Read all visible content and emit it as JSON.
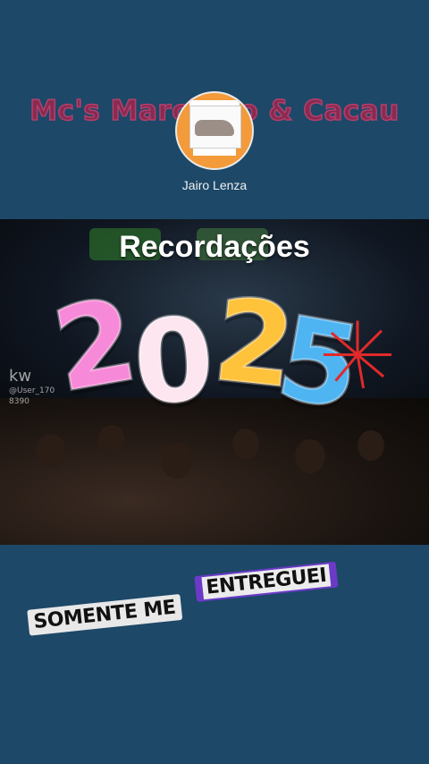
{
  "profile": {
    "overlay_title": "Mc's Marcinho & Cacau",
    "author_name": "Jairo Lenza"
  },
  "video": {
    "headline": "Recordações",
    "year_digits": [
      "2",
      "0",
      "2",
      "5"
    ],
    "watermark_app": "kw",
    "watermark_user": "@User_170",
    "watermark_id": "8390"
  },
  "caption": {
    "part1": "SOMENTE ME",
    "part2": "ENTREGUEI"
  },
  "colors": {
    "background": "#1d4868",
    "title_tint": "#8a2a50",
    "digit_pink": "#f78ad8",
    "digit_white": "#fde6f0",
    "digit_yellow": "#ffc23b",
    "digit_blue": "#4fb4f2",
    "caption_accent": "#6b3ac7"
  }
}
